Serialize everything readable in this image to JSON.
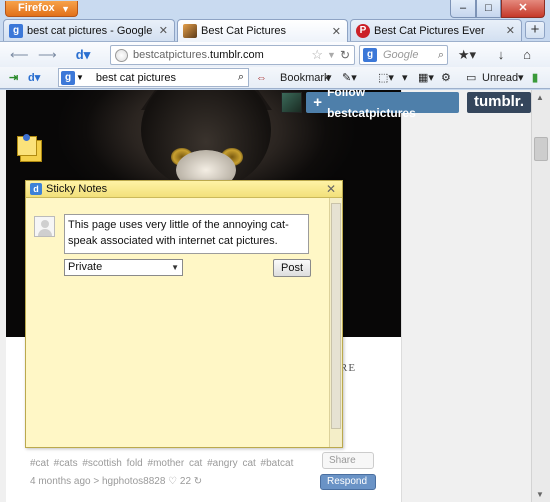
{
  "window": {
    "app_button": "Firefox",
    "min": "–",
    "max": "□",
    "close": "✕"
  },
  "tabs": [
    {
      "title": "best cat pictures - Google Search",
      "favicon": "g-icon",
      "favicon_color": "#3c78d8"
    },
    {
      "title": "Best Cat Pictures",
      "favicon": "cat-icon",
      "favicon_color": "#c47c2a"
    },
    {
      "title": "Best Cat Pictures Ever",
      "favicon": "pinterest-icon",
      "favicon_color": "#cb2027"
    }
  ],
  "navbar": {
    "url_prefix": "bestcatpictures.",
    "url_domain": "tumblr.com",
    "search_placeholder": "Google"
  },
  "toolbar": {
    "search_query": "best cat pictures",
    "bookmark_label": "Bookmark",
    "unread_label": "Unread"
  },
  "page": {
    "follow_label": "Follow bestcatpictures",
    "tumblr_logo": "tumblr.",
    "partial_text": "RE",
    "tags": "#cat  #cats  #scottish fold  #mother cat  #angry cat  #batcat",
    "meta": "4 months ago > hgphotos8828   ♡ 22   ↻",
    "share_label": "Share",
    "respond_label": "Respond"
  },
  "sticky_notes": {
    "title": "Sticky Notes",
    "note_text": "This page uses very little of the annoying cat-speak associated with internet cat pictures.",
    "privacy_value": "Private",
    "post_label": "Post"
  },
  "colors": {
    "firefox_orange": "#e2711a",
    "tumblr_follow": "#4e7faa",
    "tumblr_logo_bg": "#35465c",
    "sticky_yellow": "#fff7c6"
  }
}
